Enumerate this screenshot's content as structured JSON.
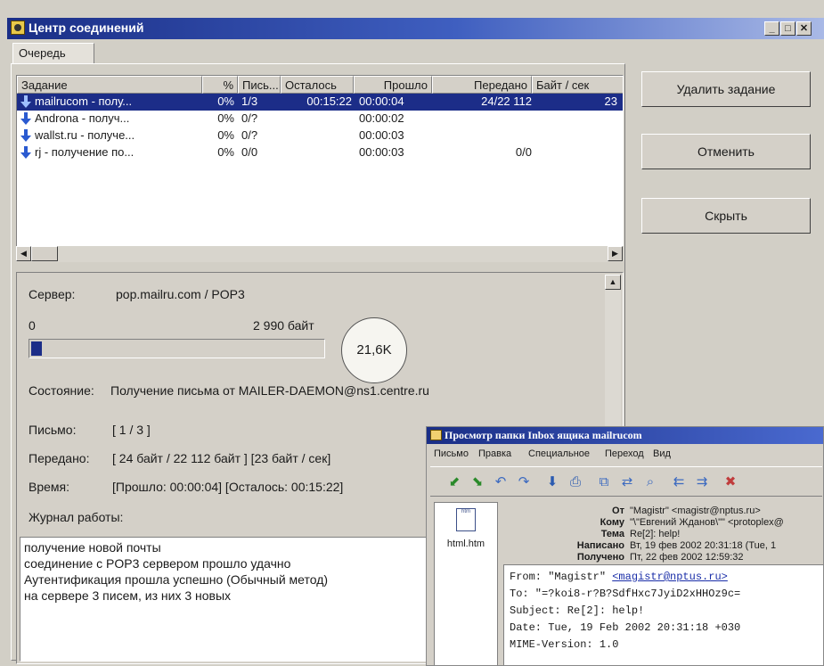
{
  "window": {
    "title": "Центр соединений",
    "tab": "Очередь"
  },
  "table": {
    "columns": [
      "Задание",
      "%",
      "Пись...",
      "Осталось",
      "Прошло",
      "Передано",
      "Байт / сек"
    ],
    "rows": [
      {
        "task": "mailrucom - полу...",
        "pct": "0%",
        "letters": "1/3",
        "remaining": "00:15:22",
        "elapsed": "00:00:04",
        "transferred": "24/22 112",
        "speed": "23",
        "selected": true
      },
      {
        "task": "Androna - получ...",
        "pct": "0%",
        "letters": "0/?",
        "remaining": "",
        "elapsed": "00:00:02",
        "transferred": "",
        "speed": ""
      },
      {
        "task": "wallst.ru - получе...",
        "pct": "0%",
        "letters": "0/?",
        "remaining": "",
        "elapsed": "00:00:03",
        "transferred": "",
        "speed": ""
      },
      {
        "task": "rj - получение по...",
        "pct": "0%",
        "letters": "0/0",
        "remaining": "",
        "elapsed": "00:00:03",
        "transferred": "0/0",
        "speed": ""
      }
    ]
  },
  "buttons": {
    "delete": "Удалить задание",
    "cancel": "Отменить",
    "hide": "Скрыть"
  },
  "details": {
    "server_label": "Сервер:",
    "server_value": "pop.mailru.com / POP3",
    "progress_min": "0",
    "progress_max": "2 990 байт",
    "progress_fraction": 0.01,
    "speed_badge": "21,6K",
    "state_label": "Состояние:",
    "state_value": "Получение письма от MAILER-DAEMON@ns1.centre.ru",
    "letter_label": "Письмо:",
    "letter_value": "[ 1 / 3 ]",
    "transferred_label": "Передано:",
    "transferred_value": "[ 24 байт / 22 112 байт ] [23 байт / сек]",
    "time_label": "Время:",
    "time_value": "[Прошло: 00:00:04] [Осталось: 00:15:22]",
    "log_label": "Журнал работы:",
    "log_lines": [
      "получение новой почты",
      "соединение с POP3 сервером прошло удачно",
      "Аутентификация прошла успешно (Обычный метод)",
      "на сервере 3 писем, из них 3 новых"
    ]
  },
  "inbox": {
    "title": "Просмотр папки Inbox ящика mailrucom",
    "menu": [
      "Письмо",
      "Правка",
      "Специальное",
      "Переход",
      "Вид"
    ],
    "file_name": "html.htm",
    "headers": [
      {
        "key": "От",
        "value": "\"Magistr\" <magistr@nptus.ru>"
      },
      {
        "key": "Кому",
        "value": "\"\\\"Евгений Жданов\\\"\" <protoplex@"
      },
      {
        "key": "Тема",
        "value": "Re[2]: help!"
      },
      {
        "key": "Написано",
        "value": "Вт, 19 фев 2002 20:31:18 (Tue, 1"
      },
      {
        "key": "Получено",
        "value": "Пт, 22 фев 2002 12:59:32"
      }
    ],
    "body": {
      "from_prefix": "From: \"Magistr\" ",
      "from_link": "<magistr@nptus.ru>",
      "to": "To: \"=?koi8-r?B?SdfHxc7JyiD2xHHOz9c=",
      "subject": "Subject: Re[2]: help!",
      "date": "Date: Tue, 19 Feb 2002 20:31:18 +030",
      "mime": "MIME-Version: 1.0"
    }
  }
}
